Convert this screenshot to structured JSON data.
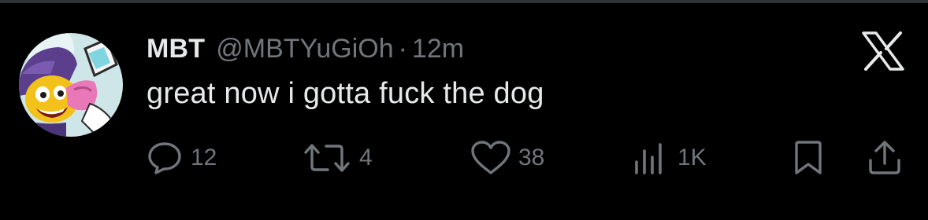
{
  "tweet": {
    "display_name": "MBT",
    "handle": "@MBTYuGiOh",
    "separator": "·",
    "time": "12m",
    "text": "great now i gotta fuck the dog"
  },
  "actions": {
    "reply_count": "12",
    "retweet_count": "4",
    "like_count": "38",
    "views_count": "1K"
  },
  "icons": {
    "platform": "x-logo-icon",
    "reply": "reply-icon",
    "retweet": "retweet-icon",
    "like": "heart-icon",
    "views": "views-bar-chart-icon",
    "bookmark": "bookmark-icon",
    "share": "share-icon"
  },
  "colors": {
    "background": "#000000",
    "primary_text": "#e7e9ea",
    "secondary_text": "#71767b",
    "divider": "#2f3336"
  }
}
